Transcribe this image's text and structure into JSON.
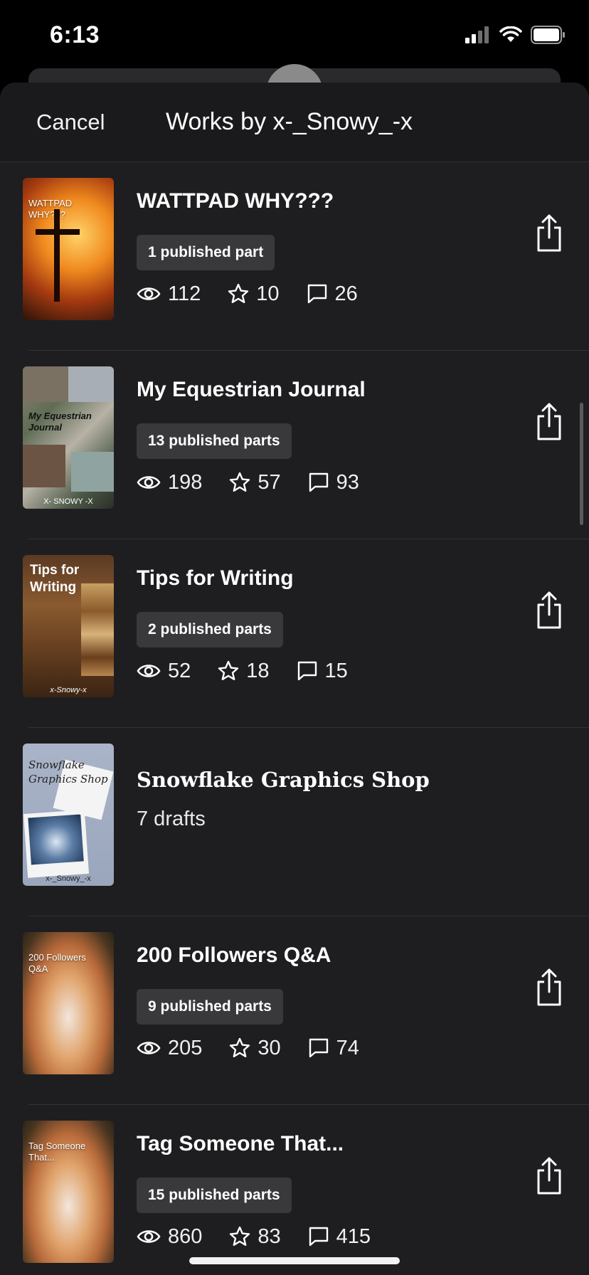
{
  "status_bar": {
    "time": "6:13"
  },
  "header": {
    "cancel_label": "Cancel",
    "title": "Works by x-_Snowy_-x"
  },
  "stories": [
    {
      "title": "WATTPAD WHY???",
      "badge": "1 published part",
      "views": "112",
      "votes": "10",
      "comments": "26",
      "cover_text": "WATTPAD WHY???"
    },
    {
      "title": "My Equestrian Journal",
      "badge": "13 published parts",
      "views": "198",
      "votes": "57",
      "comments": "93",
      "cover_text": "My Equestrian Journal",
      "cover_sub": "X- SNOWY -X"
    },
    {
      "title": "Tips for Writing",
      "badge": "2 published parts",
      "views": "52",
      "votes": "18",
      "comments": "15",
      "cover_text": "Tips for Writing",
      "cover_sub": "x-Snowy-x"
    },
    {
      "title": "Snowflake Graphics Shop",
      "drafts": "7 drafts",
      "cover_text": "Snowflake Graphics Shop",
      "cover_sub": "x-_Snowy_-x"
    },
    {
      "title": "200 Followers Q&A",
      "badge": "9 published parts",
      "views": "205",
      "votes": "30",
      "comments": "74",
      "cover_text": "200 Followers Q&A"
    },
    {
      "title": "Tag Someone That...",
      "badge": "15 published parts",
      "views": "860",
      "votes": "83",
      "comments": "415",
      "cover_text": "Tag Someone That..."
    }
  ],
  "icons": {
    "views": "eye-icon",
    "votes": "star-icon",
    "comments": "comment-icon",
    "share": "share-icon"
  },
  "colors": {
    "background": "#1e1e20",
    "header": "#1a1a1c",
    "badge": "#39393c"
  }
}
